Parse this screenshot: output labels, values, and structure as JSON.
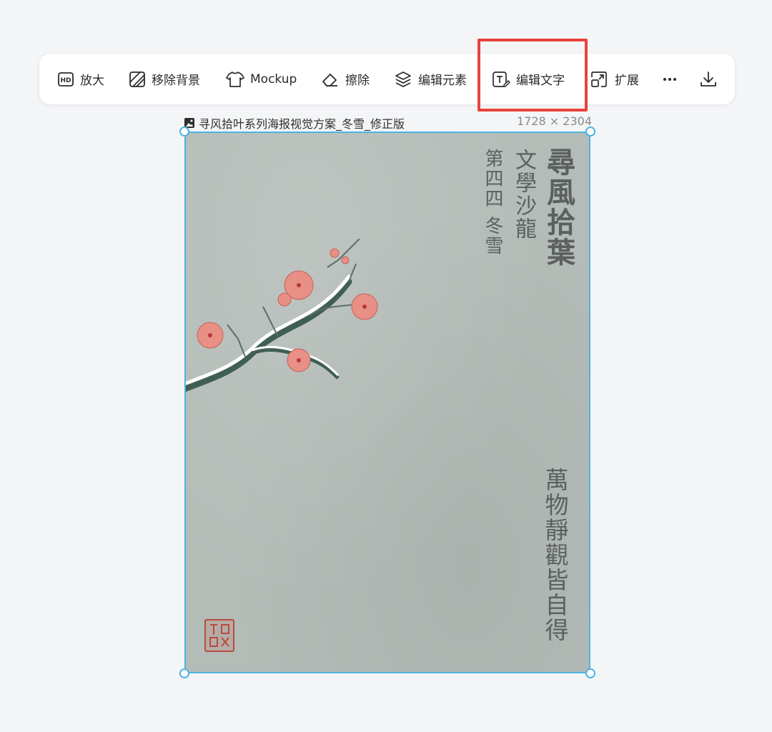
{
  "toolbar": {
    "items": [
      {
        "label": "放大",
        "icon": "hd-icon"
      },
      {
        "label": "移除背景",
        "icon": "remove-background-icon"
      },
      {
        "label": "Mockup",
        "icon": "tshirt-icon"
      },
      {
        "label": "擦除",
        "icon": "eraser-icon"
      },
      {
        "label": "编辑元素",
        "icon": "layers-icon"
      },
      {
        "label": "编辑文字",
        "icon": "edit-text-icon"
      },
      {
        "label": "扩展",
        "icon": "expand-icon"
      }
    ],
    "more_icon": "more-icon",
    "download_icon": "download-icon",
    "highlight_color": "#e8423c"
  },
  "file": {
    "name": "寻风拾叶系列海报视觉方案_冬雪_修正版",
    "dimensions": "1728 × 2304"
  },
  "poster": {
    "title": "尋風拾葉",
    "subtitle": "文學沙龍",
    "issue": "第四四 冬雪",
    "motto": "萬物靜觀皆自得",
    "background_color": "#b4bcb8",
    "blossom_color": "#e88f86"
  },
  "selection_color": "#4fb3e0"
}
